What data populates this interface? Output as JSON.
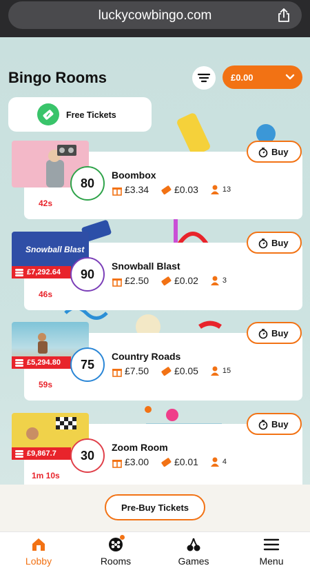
{
  "browser": {
    "url": "luckycowbingo.com"
  },
  "header": {
    "title": "Bingo Rooms",
    "balance": "£0.00"
  },
  "free_tickets": {
    "label": "Free Tickets"
  },
  "rooms": [
    {
      "name": "Boombox",
      "ball": "80",
      "ball_color": "#2fa34a",
      "prize": "£3.34",
      "ticket_price": "£0.03",
      "players": "13",
      "timer": "42s",
      "jackpot": "",
      "buy_label": "Buy"
    },
    {
      "name": "Snowball Blast",
      "ball": "90",
      "ball_color": "#7b3fb8",
      "prize": "£2.50",
      "ticket_price": "£0.02",
      "players": "3",
      "timer": "46s",
      "jackpot": "£7,292.64",
      "buy_label": "Buy",
      "thumb_text": "Snowball Blast"
    },
    {
      "name": "Country Roads",
      "ball": "75",
      "ball_color": "#2a86d6",
      "prize": "£7.50",
      "ticket_price": "£0.05",
      "players": "15",
      "timer": "59s",
      "jackpot": "£5,294.80",
      "buy_label": "Buy"
    },
    {
      "name": "Zoom Room",
      "ball": "30",
      "ball_color": "#e0404a",
      "prize": "£3.00",
      "ticket_price": "£0.01",
      "players": "4",
      "timer": "1m 10s",
      "jackpot": "£9,867.7",
      "buy_label": "Buy"
    }
  ],
  "prebuy": {
    "label": "Pre-Buy Tickets"
  },
  "nav": {
    "items": [
      {
        "label": "Lobby",
        "icon": "house-icon",
        "active": true
      },
      {
        "label": "Rooms",
        "icon": "bingo-balls-icon",
        "badge": true
      },
      {
        "label": "Games",
        "icon": "cherries-icon"
      },
      {
        "label": "Menu",
        "icon": "hamburger-icon"
      }
    ]
  },
  "colors": {
    "accent": "#f27214",
    "timer": "#e8242b",
    "free_ticket_icon": "#39c46a"
  }
}
